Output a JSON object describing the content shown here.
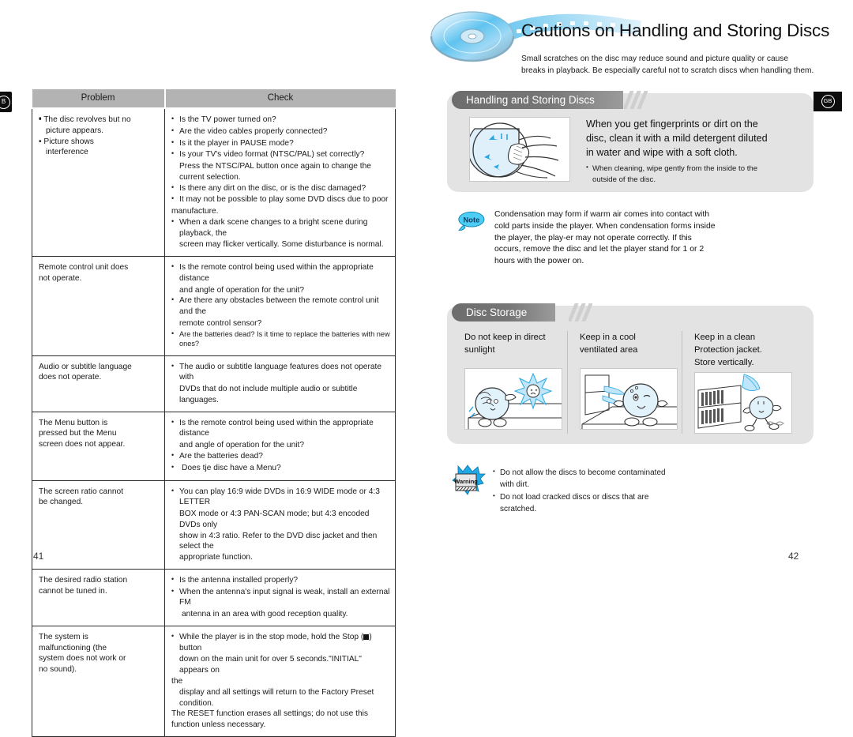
{
  "left_page": {
    "page_number": "41",
    "edge_badge": "B",
    "table": {
      "headers": [
        "Problem",
        "Check"
      ],
      "rows": [
        {
          "problem_lines": [
            "• The disc revolves but no",
            "picture appears.",
            "• Picture shows",
            "interference"
          ],
          "checks": [
            "Is the TV power turned on?",
            "Are the video cables properly connected?",
            "Is it the player in PAUSE mode?",
            "Is your TV's video format (NTSC/PAL) set correctly?",
            "Press the NTSC/PAL button once again to change the current selection.",
            "Is there any dirt on the disc, or is the disc damaged?",
            "It may not be possible to play some DVD discs due to poor",
            "manufacture.",
            "When a dark scene changes to a bright scene during playback, the",
            "screen may flicker vertically. Some disturbance is normal."
          ]
        },
        {
          "problem_lines": [
            "Remote control unit does",
            "not operate."
          ],
          "checks": [
            "Is the remote control being used within the appropriate distance",
            "and angle of operation for the unit?",
            "Are there any obstacles between the remote control unit and the",
            "remote control sensor?",
            "Are the batteries dead? Is it time to replace the batteries with new ones?"
          ]
        },
        {
          "problem_lines": [
            "Audio or subtitle language",
            "does not operate."
          ],
          "checks": [
            "The audio or subtitle language features does not operate with",
            "DVDs that do not include multiple audio or subtitle languages."
          ]
        },
        {
          "problem_lines": [
            "The Menu button is",
            "pressed but the Menu",
            "screen does not appear."
          ],
          "checks": [
            "Is the remote control being used within the appropriate distance",
            "and angle of operation for the unit?",
            "Are the batteries dead?",
            "Does tje disc have a Menu?"
          ]
        },
        {
          "problem_lines": [
            "The screen ratio cannot",
            "be changed."
          ],
          "checks": [
            "You can play 16:9 wide DVDs in 16:9 WIDE mode or 4:3 LETTER",
            "BOX mode or 4:3 PAN-SCAN mode; but 4:3 encoded DVDs only",
            "show in 4:3 ratio. Refer to the DVD disc jacket and then select the",
            "appropriate function."
          ]
        },
        {
          "problem_lines": [
            "The desired radio station",
            "cannot be tuned in."
          ],
          "checks": [
            "Is the antenna installed properly?",
            "When the antenna's input signal is weak, install an external FM",
            "antenna in an area with good reception quality."
          ]
        },
        {
          "problem_lines": [
            "The system is",
            "malfunctioning (the",
            "system does not work or",
            "no sound)."
          ],
          "checks": [
            "While the player is in the stop mode, hold the Stop (",
            ") button",
            "down on the main unit for over 5 seconds.\"INITIAL\" appears on",
            "the",
            "display and all settings will return to the Factory Preset condition.",
            "The RESET function erases all settings; do not use this",
            "function unless necessary."
          ]
        }
      ]
    }
  },
  "right_page": {
    "page_number": "42",
    "region_badge": "GB",
    "header": {
      "title": "Cautions on Handling and Storing Discs",
      "subtitle_line1": "Small scratches on the disc may reduce sound and picture quality or cause",
      "subtitle_line2": "breaks in playback. Be especially careful not to scratch discs when handling them."
    },
    "handling_section": {
      "title": "Handling and Storing Discs",
      "body_line1": "When you get fingerprints or dirt on the",
      "body_line2": "disc, clean it with a mild detergent diluted",
      "body_line3": "in water and wipe with a soft cloth.",
      "bullet_line1": "When cleaning, wipe gently from the inside to the",
      "bullet_line2": "outside of the disc.",
      "illustration": "hand-wiping-disc-illustration"
    },
    "note": {
      "label": "Note",
      "text": "Condensation may form if warm air comes into contact with cold parts inside the player. When condensation forms inside the player, the play-er may not operate correctly. If this occurs, remove the disc and let the player stand for 1 or 2 hours with the power on."
    },
    "storage_section": {
      "title": "Disc Storage",
      "columns": [
        {
          "caption_line1": "Do not keep in direct",
          "caption_line2": "sunlight",
          "caption_line3": "",
          "illustration": "disc-character-in-sunlight-illustration"
        },
        {
          "caption_line1": "Keep in a cool",
          "caption_line2": "ventilated area",
          "caption_line3": "",
          "illustration": "disc-character-near-window-illustration"
        },
        {
          "caption_line1": "Keep in a clean",
          "caption_line2": "Protection jacket.",
          "caption_line3": "Store vertically.",
          "illustration": "disc-character-with-shelf-illustration"
        }
      ]
    },
    "warning": {
      "label": "Warning",
      "items": [
        "Do not allow the discs to become contaminated with dirt.",
        "Do not load cracked discs or discs that are scratched."
      ],
      "item1_line1": "Do not allow the discs to become contaminated",
      "item1_line2": "with dirt.",
      "item2_line1": "Do not load cracked discs or discs that are",
      "item2_line2": "scratched."
    }
  },
  "colors": {
    "table_header_gray": "#b3b3b3",
    "panel_gray": "#e3e3e3",
    "section_bar_dark": "#6d6d6d",
    "accent_blue": "#2aa8e0",
    "note_blue": "#3ec6f0",
    "badge_black": "#0d0d0d"
  }
}
